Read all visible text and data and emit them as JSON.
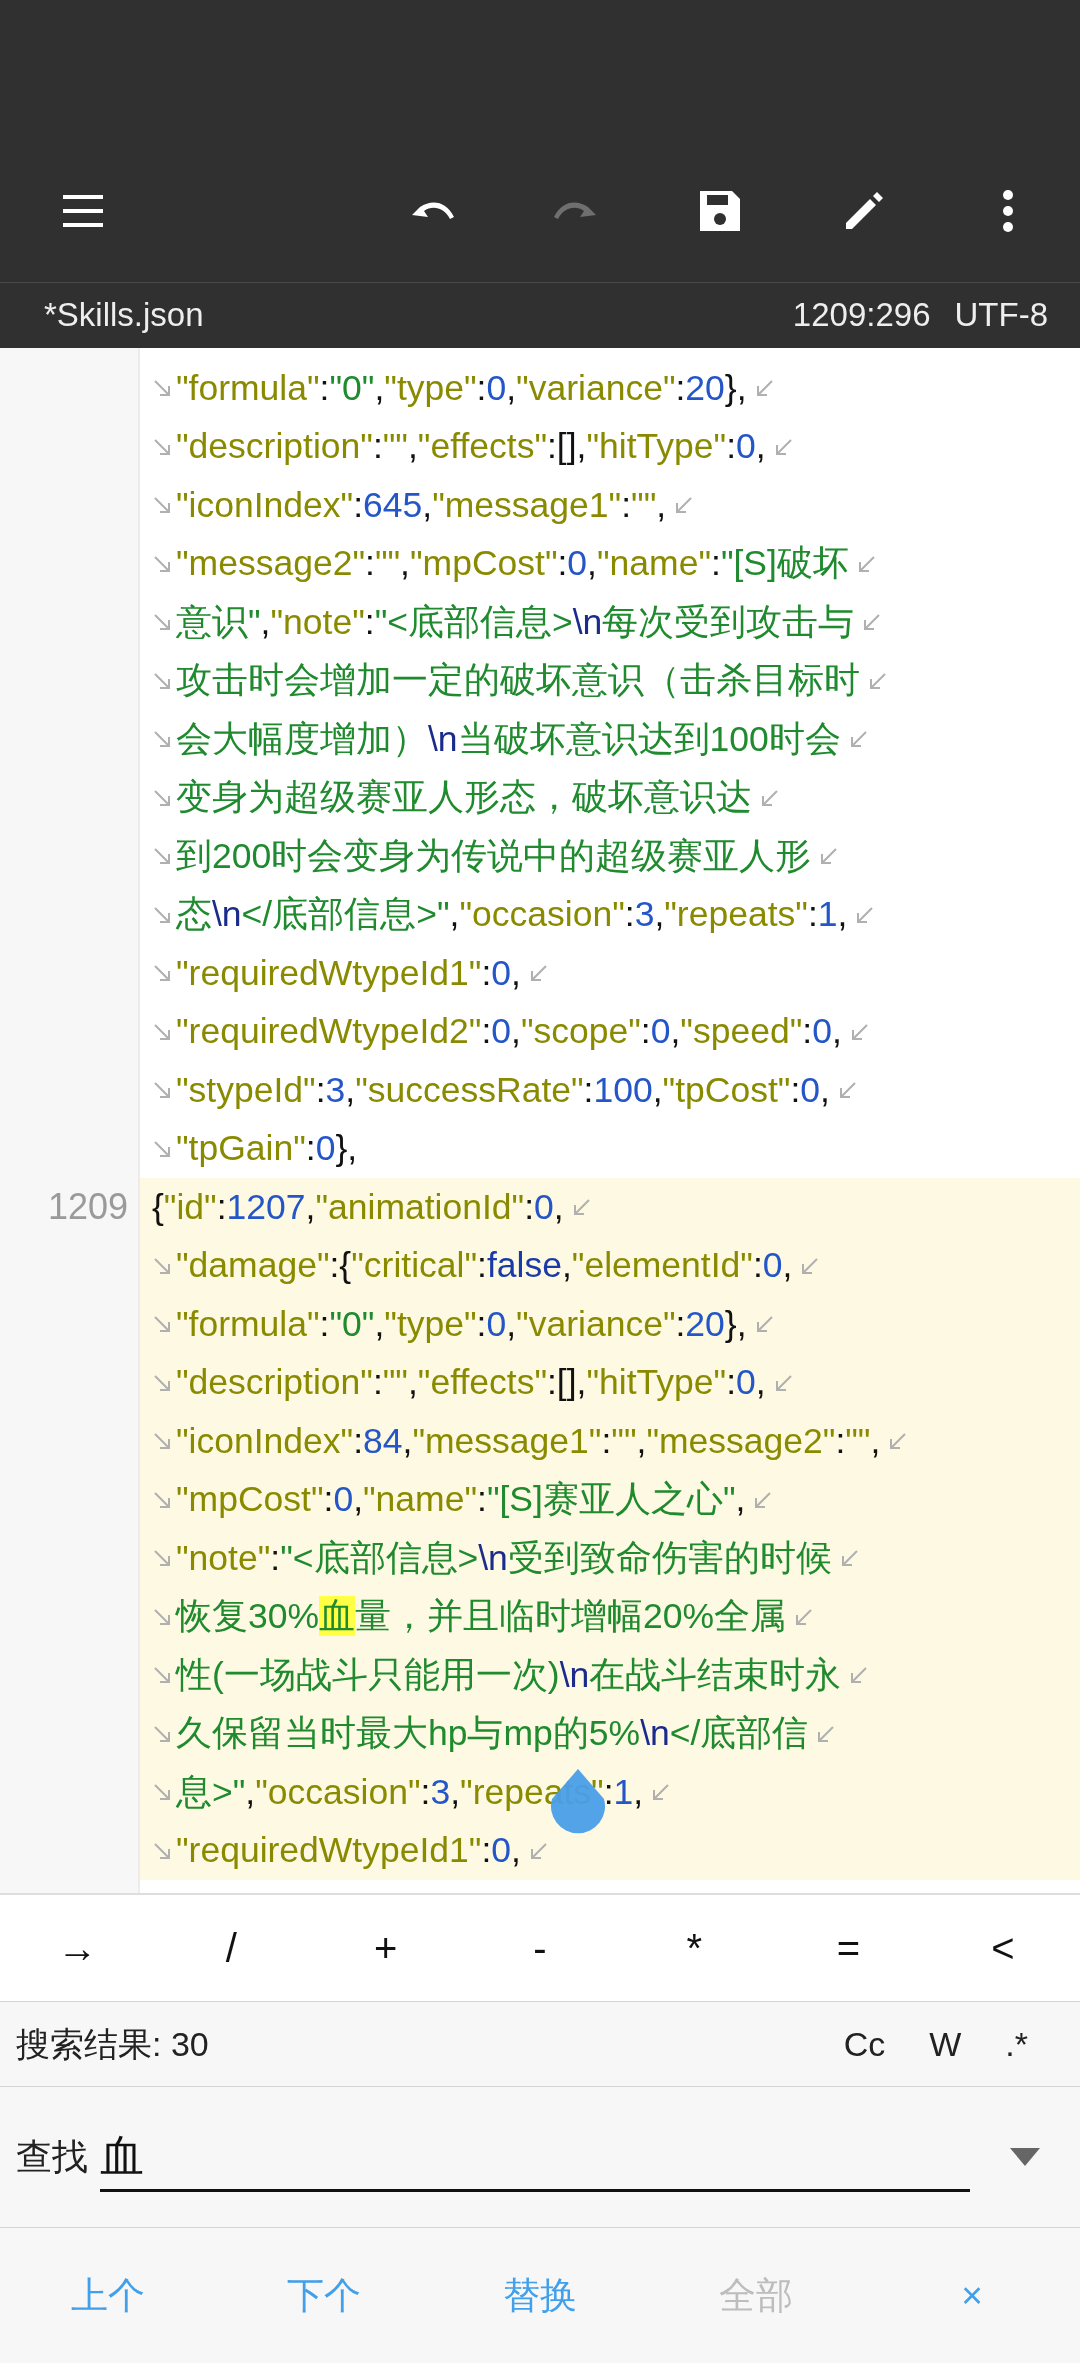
{
  "toolbar": [
    {
      "kind": "menu",
      "disabled": false
    },
    {
      "kind": "undo",
      "disabled": false
    },
    {
      "kind": "redo",
      "disabled": true
    },
    {
      "kind": "save",
      "disabled": false
    },
    {
      "kind": "edit",
      "disabled": false
    },
    {
      "kind": "more",
      "disabled": false
    }
  ],
  "file_bar": {
    "file_name": "*Skills.json",
    "cursor_position": "1209:296",
    "encoding": "UTF-8"
  },
  "code_lines": [
    {
      "current": false,
      "continued": true,
      "wraps": true,
      "tokens": [
        {
          "kind": "key",
          "text": "\"formula\""
        },
        {
          "kind": "punct",
          "text": ":"
        },
        {
          "kind": "str",
          "text": "\"0\""
        },
        {
          "kind": "punct",
          "text": ","
        },
        {
          "kind": "key",
          "text": "\"type\""
        },
        {
          "kind": "punct",
          "text": ":"
        },
        {
          "kind": "num",
          "text": "0"
        },
        {
          "kind": "punct",
          "text": ","
        },
        {
          "kind": "key",
          "text": "\"variance\""
        },
        {
          "kind": "punct",
          "text": ":"
        },
        {
          "kind": "num",
          "text": "20"
        },
        {
          "kind": "punct",
          "text": "},"
        }
      ]
    },
    {
      "current": false,
      "continued": true,
      "wraps": true,
      "tokens": [
        {
          "kind": "key",
          "text": "\"description\""
        },
        {
          "kind": "punct",
          "text": ":"
        },
        {
          "kind": "key",
          "text": "\"\""
        },
        {
          "kind": "punct",
          "text": ","
        },
        {
          "kind": "key",
          "text": "\"effects\""
        },
        {
          "kind": "punct",
          "text": ":[],"
        },
        {
          "kind": "key",
          "text": "\"hitType\""
        },
        {
          "kind": "punct",
          "text": ":"
        },
        {
          "kind": "num",
          "text": "0"
        },
        {
          "kind": "punct",
          "text": ","
        }
      ]
    },
    {
      "current": false,
      "continued": true,
      "wraps": true,
      "tokens": [
        {
          "kind": "key",
          "text": "\"iconIndex\""
        },
        {
          "kind": "punct",
          "text": ":"
        },
        {
          "kind": "num",
          "text": "645"
        },
        {
          "kind": "punct",
          "text": ","
        },
        {
          "kind": "key",
          "text": "\"message1\""
        },
        {
          "kind": "punct",
          "text": ":"
        },
        {
          "kind": "key",
          "text": "\"\""
        },
        {
          "kind": "punct",
          "text": ","
        }
      ]
    },
    {
      "current": false,
      "continued": true,
      "wraps": true,
      "tokens": [
        {
          "kind": "key",
          "text": "\"message2\""
        },
        {
          "kind": "punct",
          "text": ":"
        },
        {
          "kind": "key",
          "text": "\"\""
        },
        {
          "kind": "punct",
          "text": ","
        },
        {
          "kind": "key",
          "text": "\"mpCost\""
        },
        {
          "kind": "punct",
          "text": ":"
        },
        {
          "kind": "num",
          "text": "0"
        },
        {
          "kind": "punct",
          "text": ","
        },
        {
          "kind": "key",
          "text": "\"name\""
        },
        {
          "kind": "punct",
          "text": ":"
        },
        {
          "kind": "str",
          "text": "\"[S]破坏"
        }
      ]
    },
    {
      "current": false,
      "continued": true,
      "wraps": true,
      "tokens": [
        {
          "kind": "str",
          "text": "意识\""
        },
        {
          "kind": "punct",
          "text": ","
        },
        {
          "kind": "key",
          "text": "\"note\""
        },
        {
          "kind": "punct",
          "text": ":"
        },
        {
          "kind": "str",
          "text": "\"<底部信息>"
        },
        {
          "kind": "esc",
          "text": "\\n"
        },
        {
          "kind": "str",
          "text": "每次受到攻击与"
        }
      ]
    },
    {
      "current": false,
      "continued": true,
      "wraps": true,
      "tokens": [
        {
          "kind": "str",
          "text": "攻击时会增加一定的破坏意识（击杀目标时"
        }
      ]
    },
    {
      "current": false,
      "continued": true,
      "wraps": true,
      "tokens": [
        {
          "kind": "str",
          "text": "会大幅度增加）"
        },
        {
          "kind": "esc",
          "text": "\\n"
        },
        {
          "kind": "str",
          "text": "当破坏意识达到100时会"
        }
      ]
    },
    {
      "current": false,
      "continued": true,
      "wraps": true,
      "tokens": [
        {
          "kind": "str",
          "text": "变身为超级赛亚人形态，破坏意识达"
        }
      ]
    },
    {
      "current": false,
      "continued": true,
      "wraps": true,
      "tokens": [
        {
          "kind": "str",
          "text": "到200时会变身为传说中的超级赛亚人形"
        }
      ]
    },
    {
      "current": false,
      "continued": true,
      "wraps": true,
      "tokens": [
        {
          "kind": "str",
          "text": "态"
        },
        {
          "kind": "esc",
          "text": "\\n"
        },
        {
          "kind": "str",
          "text": "</底部信息>\""
        },
        {
          "kind": "punct",
          "text": ","
        },
        {
          "kind": "key",
          "text": "\"occasion\""
        },
        {
          "kind": "punct",
          "text": ":"
        },
        {
          "kind": "num",
          "text": "3"
        },
        {
          "kind": "punct",
          "text": ","
        },
        {
          "kind": "key",
          "text": "\"repeats\""
        },
        {
          "kind": "punct",
          "text": ":"
        },
        {
          "kind": "num",
          "text": "1"
        },
        {
          "kind": "punct",
          "text": ","
        }
      ]
    },
    {
      "current": false,
      "continued": true,
      "wraps": true,
      "tokens": [
        {
          "kind": "key",
          "text": "\"requiredWtypeId1\""
        },
        {
          "kind": "punct",
          "text": ":"
        },
        {
          "kind": "num",
          "text": "0"
        },
        {
          "kind": "punct",
          "text": ","
        }
      ]
    },
    {
      "current": false,
      "continued": true,
      "wraps": true,
      "tokens": [
        {
          "kind": "key",
          "text": "\"requiredWtypeId2\""
        },
        {
          "kind": "punct",
          "text": ":"
        },
        {
          "kind": "num",
          "text": "0"
        },
        {
          "kind": "punct",
          "text": ","
        },
        {
          "kind": "key",
          "text": "\"scope\""
        },
        {
          "kind": "punct",
          "text": ":"
        },
        {
          "kind": "num",
          "text": "0"
        },
        {
          "kind": "punct",
          "text": ","
        },
        {
          "kind": "key",
          "text": "\"speed\""
        },
        {
          "kind": "punct",
          "text": ":"
        },
        {
          "kind": "num",
          "text": "0"
        },
        {
          "kind": "punct",
          "text": ","
        }
      ]
    },
    {
      "current": false,
      "continued": true,
      "wraps": true,
      "tokens": [
        {
          "kind": "key",
          "text": "\"stypeId\""
        },
        {
          "kind": "punct",
          "text": ":"
        },
        {
          "kind": "num",
          "text": "3"
        },
        {
          "kind": "punct",
          "text": ","
        },
        {
          "kind": "key",
          "text": "\"successRate\""
        },
        {
          "kind": "punct",
          "text": ":"
        },
        {
          "kind": "num",
          "text": "100"
        },
        {
          "kind": "punct",
          "text": ","
        },
        {
          "kind": "key",
          "text": "\"tpCost\""
        },
        {
          "kind": "punct",
          "text": ":"
        },
        {
          "kind": "num",
          "text": "0"
        },
        {
          "kind": "punct",
          "text": ","
        }
      ]
    },
    {
      "current": false,
      "continued": true,
      "wraps": false,
      "tokens": [
        {
          "kind": "key",
          "text": "\"tpGain\""
        },
        {
          "kind": "punct",
          "text": ":"
        },
        {
          "kind": "num",
          "text": "0"
        },
        {
          "kind": "punct",
          "text": "},"
        }
      ]
    },
    {
      "number": "1209",
      "current": true,
      "continued": false,
      "wraps": true,
      "tokens": [
        {
          "kind": "punct",
          "text": "{"
        },
        {
          "kind": "key",
          "text": "\"id\""
        },
        {
          "kind": "punct",
          "text": ":"
        },
        {
          "kind": "num",
          "text": "1207"
        },
        {
          "kind": "punct",
          "text": ","
        },
        {
          "kind": "key",
          "text": "\"animationId\""
        },
        {
          "kind": "punct",
          "text": ":"
        },
        {
          "kind": "num",
          "text": "0"
        },
        {
          "kind": "punct",
          "text": ","
        }
      ]
    },
    {
      "current": true,
      "continued": true,
      "wraps": true,
      "tokens": [
        {
          "kind": "key",
          "text": "\"damage\""
        },
        {
          "kind": "punct",
          "text": ":{"
        },
        {
          "kind": "key",
          "text": "\"critical\""
        },
        {
          "kind": "punct",
          "text": ":"
        },
        {
          "kind": "bool",
          "text": "false"
        },
        {
          "kind": "punct",
          "text": ","
        },
        {
          "kind": "key",
          "text": "\"elementId\""
        },
        {
          "kind": "punct",
          "text": ":"
        },
        {
          "kind": "num",
          "text": "0"
        },
        {
          "kind": "punct",
          "text": ","
        }
      ]
    },
    {
      "current": true,
      "continued": true,
      "wraps": true,
      "tokens": [
        {
          "kind": "key",
          "text": "\"formula\""
        },
        {
          "kind": "punct",
          "text": ":"
        },
        {
          "kind": "str",
          "text": "\"0\""
        },
        {
          "kind": "punct",
          "text": ","
        },
        {
          "kind": "key",
          "text": "\"type\""
        },
        {
          "kind": "punct",
          "text": ":"
        },
        {
          "kind": "num",
          "text": "0"
        },
        {
          "kind": "punct",
          "text": ","
        },
        {
          "kind": "key",
          "text": "\"variance\""
        },
        {
          "kind": "punct",
          "text": ":"
        },
        {
          "kind": "num",
          "text": "20"
        },
        {
          "kind": "punct",
          "text": "},"
        }
      ]
    },
    {
      "current": true,
      "continued": true,
      "wraps": true,
      "tokens": [
        {
          "kind": "key",
          "text": "\"description\""
        },
        {
          "kind": "punct",
          "text": ":"
        },
        {
          "kind": "key",
          "text": "\"\""
        },
        {
          "kind": "punct",
          "text": ","
        },
        {
          "kind": "key",
          "text": "\"effects\""
        },
        {
          "kind": "punct",
          "text": ":[],"
        },
        {
          "kind": "key",
          "text": "\"hitType\""
        },
        {
          "kind": "punct",
          "text": ":"
        },
        {
          "kind": "num",
          "text": "0"
        },
        {
          "kind": "punct",
          "text": ","
        }
      ]
    },
    {
      "current": true,
      "continued": true,
      "wraps": true,
      "tokens": [
        {
          "kind": "key",
          "text": "\"iconIndex\""
        },
        {
          "kind": "punct",
          "text": ":"
        },
        {
          "kind": "num",
          "text": "84"
        },
        {
          "kind": "punct",
          "text": ","
        },
        {
          "kind": "key",
          "text": "\"message1\""
        },
        {
          "kind": "punct",
          "text": ":"
        },
        {
          "kind": "key",
          "text": "\"\""
        },
        {
          "kind": "punct",
          "text": ","
        },
        {
          "kind": "key",
          "text": "\"message2\""
        },
        {
          "kind": "punct",
          "text": ":"
        },
        {
          "kind": "key",
          "text": "\"\""
        },
        {
          "kind": "punct",
          "text": ","
        }
      ]
    },
    {
      "current": true,
      "continued": true,
      "wraps": true,
      "tokens": [
        {
          "kind": "key",
          "text": "\"mpCost\""
        },
        {
          "kind": "punct",
          "text": ":"
        },
        {
          "kind": "num",
          "text": "0"
        },
        {
          "kind": "punct",
          "text": ","
        },
        {
          "kind": "key",
          "text": "\"name\""
        },
        {
          "kind": "punct",
          "text": ":"
        },
        {
          "kind": "str",
          "text": "\"[S]赛亚人之心\""
        },
        {
          "kind": "punct",
          "text": ","
        }
      ]
    },
    {
      "current": true,
      "continued": true,
      "wraps": true,
      "tokens": [
        {
          "kind": "key",
          "text": "\"note\""
        },
        {
          "kind": "punct",
          "text": ":"
        },
        {
          "kind": "str",
          "text": "\"<底部信息>"
        },
        {
          "kind": "esc",
          "text": "\\n"
        },
        {
          "kind": "str",
          "text": "受到致命伤害的时候"
        }
      ]
    },
    {
      "current": true,
      "continued": true,
      "wraps": true,
      "tokens": [
        {
          "kind": "str",
          "text": "恢复30%"
        },
        {
          "kind": "match",
          "text": "血"
        },
        {
          "kind": "str",
          "text": "量，并且临时增幅20%全属"
        }
      ]
    },
    {
      "current": true,
      "continued": true,
      "wraps": true,
      "tokens": [
        {
          "kind": "str",
          "text": "性(一场战斗只能用一次)"
        },
        {
          "kind": "esc",
          "text": "\\n"
        },
        {
          "kind": "str",
          "text": "在战斗结束时永"
        }
      ]
    },
    {
      "current": true,
      "continued": true,
      "wraps": true,
      "tokens": [
        {
          "kind": "str",
          "text": "久保留当时最大hp与mp的5%"
        },
        {
          "kind": "esc",
          "text": "\\n"
        },
        {
          "kind": "str",
          "text": "</底部信"
        }
      ]
    },
    {
      "current": true,
      "continued": true,
      "wraps": true,
      "tokens": [
        {
          "kind": "str",
          "text": "息>\""
        },
        {
          "kind": "punct",
          "text": ","
        },
        {
          "kind": "key",
          "text": "\"occasion\""
        },
        {
          "kind": "punct",
          "text": ":"
        },
        {
          "kind": "num",
          "text": "3"
        },
        {
          "kind": "punct",
          "text": ","
        },
        {
          "kind": "key",
          "text": "\"repeats\""
        },
        {
          "kind": "punct",
          "text": ":"
        },
        {
          "kind": "num",
          "text": "1"
        },
        {
          "kind": "punct",
          "text": ","
        }
      ]
    },
    {
      "current": true,
      "continued": true,
      "wraps": true,
      "tokens": [
        {
          "kind": "key",
          "text": "\"requiredWtypeId1\""
        },
        {
          "kind": "punct",
          "text": ":"
        },
        {
          "kind": "num",
          "text": "0"
        },
        {
          "kind": "punct",
          "text": ","
        }
      ]
    }
  ],
  "symbol_keys": [
    "→",
    "/",
    "+",
    "-",
    "*",
    "=",
    "<"
  ],
  "search": {
    "result_label": "搜索结果: 30",
    "options": [
      "Cc",
      "W",
      ".*"
    ],
    "find_label": "查找",
    "find_value": "血"
  },
  "actions": [
    {
      "label": "上个",
      "disabled": false
    },
    {
      "label": "下个",
      "disabled": false
    },
    {
      "label": "替换",
      "disabled": false
    },
    {
      "label": "全部",
      "disabled": true
    },
    {
      "label": "×",
      "disabled": false
    }
  ]
}
